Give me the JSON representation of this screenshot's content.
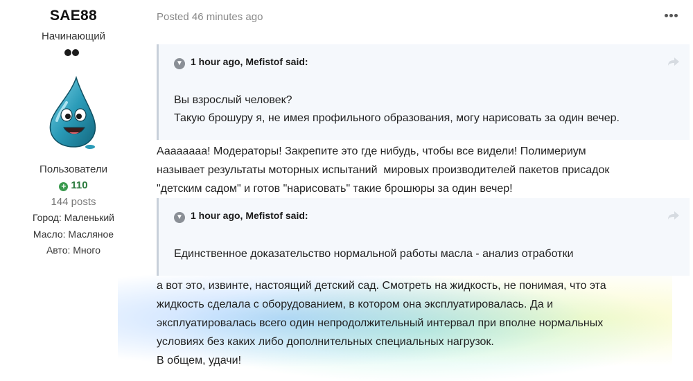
{
  "author": {
    "name": "SAE88",
    "rank": "Начинающий",
    "group": "Пользователи",
    "reputation": "110",
    "posts": "144 posts",
    "fields": [
      "Город: Маленький",
      "Масло: Масляное",
      "Авто: Много"
    ]
  },
  "post": {
    "posted": "Posted 46 minutes ago",
    "quotes": [
      {
        "header": "1 hour ago, Mefistof said:",
        "lines": [
          "Вы взрослый человек?",
          "Такую брошуру я, не имея профильного образования, могу нарисовать за один вечер."
        ]
      },
      {
        "header": "1 hour ago, Mefistof said:",
        "lines": [
          "Единственное доказательство нормальной работы масла - анализ отработки"
        ]
      }
    ],
    "paragraph1": [
      "Аааааааа! Модераторы! Закрепите это где нибудь, чтобы все видели! Полимериум",
      "называет результаты моторных испытаний  мировых производителей пакетов присадок",
      "\"детским садом\" и готов \"нарисовать\" такие брошюры за один вечер!"
    ],
    "paragraph2": [
      "а вот это, извинте, настоящий детский сад. Смотреть на жидкость, не понимая, что эта",
      "жидкость сделала с оборудованием, в котором она эксплуатировалась. Да и",
      "эксплуатировалась всего один непродолжительный интервал при вполне нормальных",
      "условиях без каких либо дополнительных специальных нагрузок.",
      "В общем, удачи!"
    ]
  },
  "icons": {
    "rank_pips": "rank-pips-icon",
    "reputation": "plus-circle-icon",
    "more": "ellipsis-icon",
    "quote_toggle": "chevron-down-icon",
    "quote_share": "share-arrow-icon"
  },
  "colors": {
    "reputation": "#2a7a3d",
    "quote_bg": "#f5f8fc",
    "quote_border": "#c8d0da",
    "muted_text": "#8a8a8a"
  }
}
